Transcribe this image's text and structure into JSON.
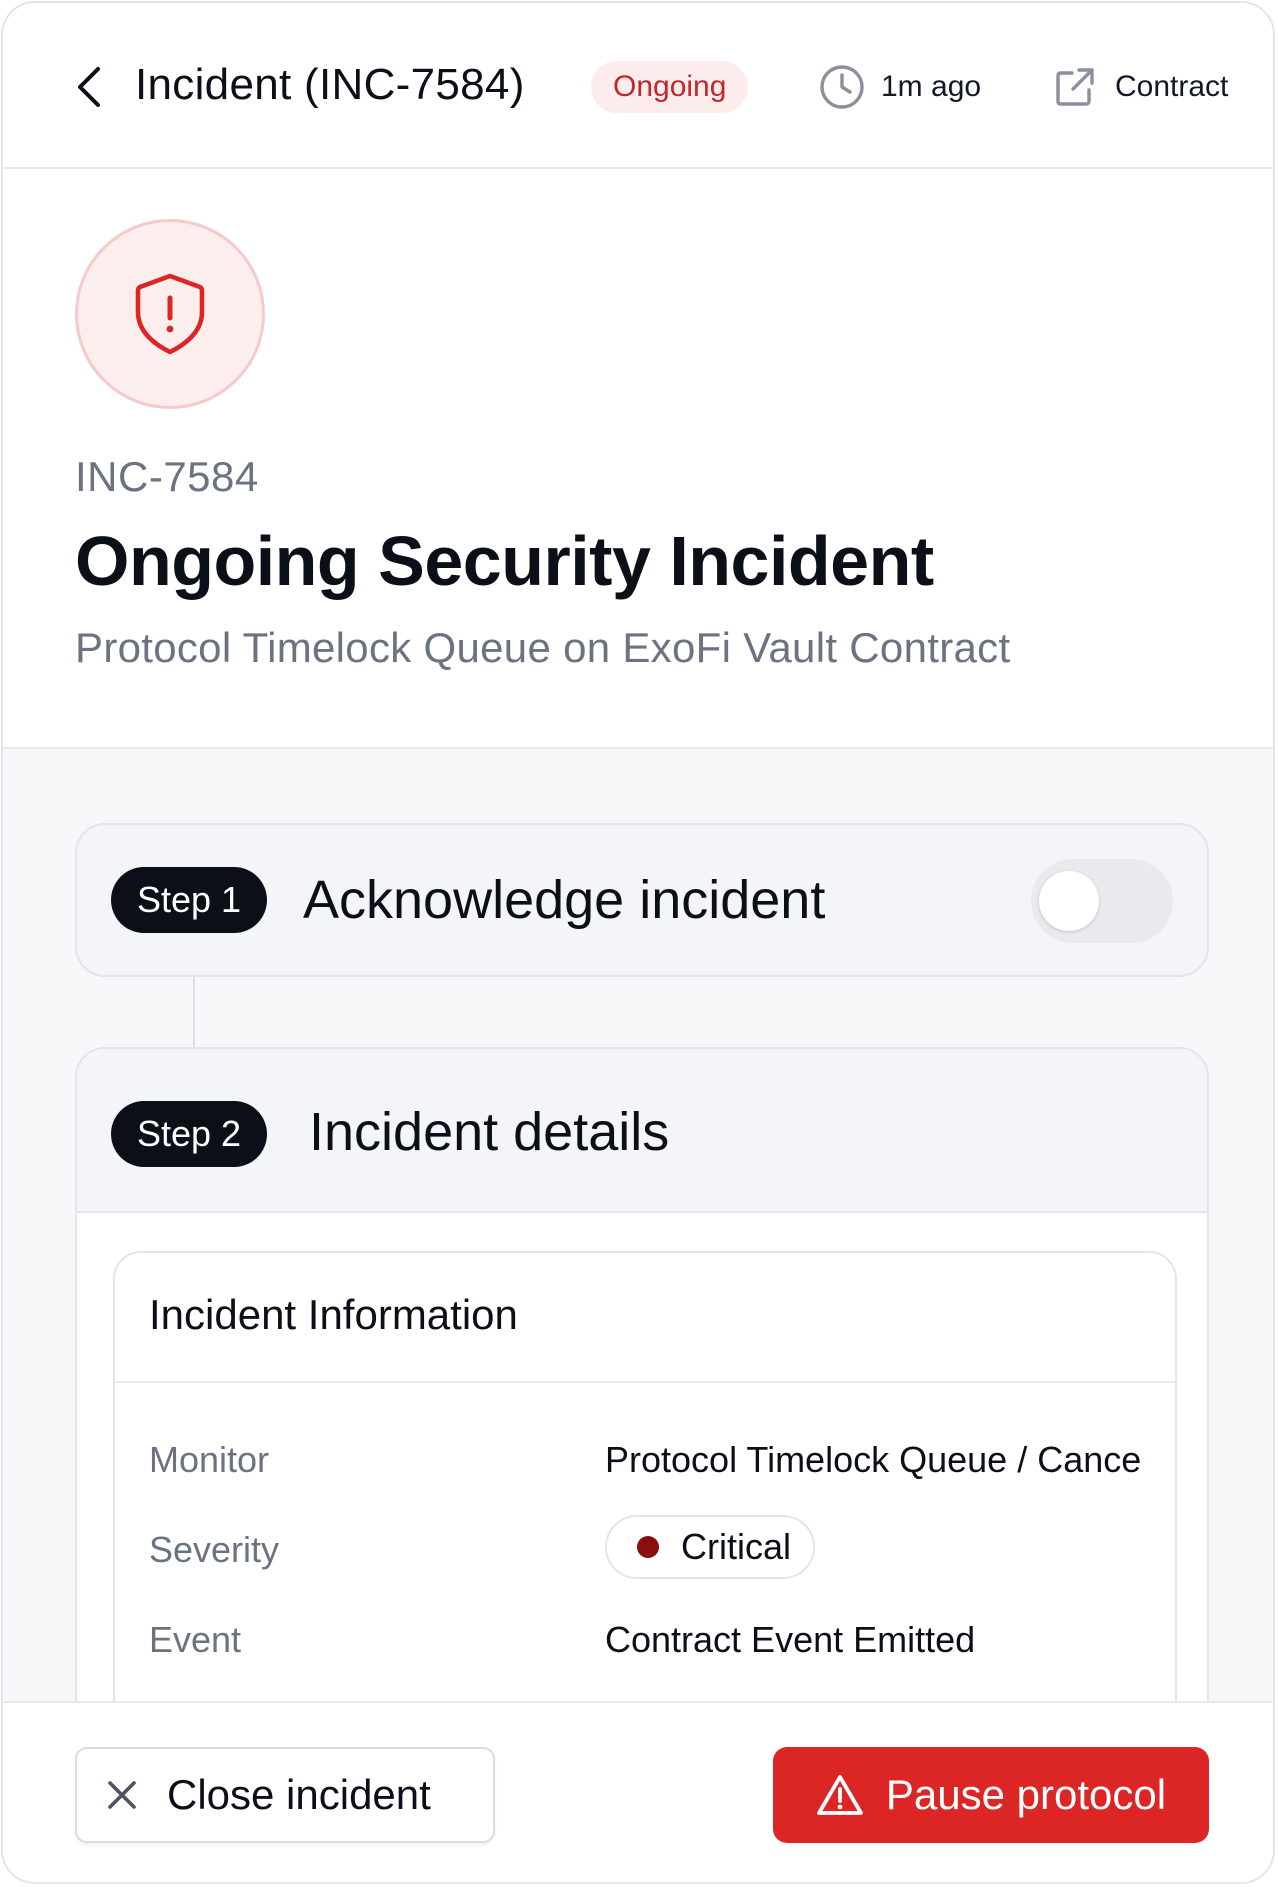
{
  "header": {
    "title": "Incident (INC-7584)",
    "status": "Ongoing",
    "time_ago": "1m ago",
    "contract_label": "Contract"
  },
  "hero": {
    "incident_id": "INC-7584",
    "title": "Ongoing Security Incident",
    "subtitle": "Protocol Timelock Queue on ExoFi Vault Contract",
    "icon": "shield-alert-icon"
  },
  "steps": [
    {
      "badge": "Step 1",
      "title": "Acknowledge incident",
      "toggle_on": false
    },
    {
      "badge": "Step 2",
      "title": "Incident details"
    }
  ],
  "incident_info": {
    "title": "Incident Information",
    "rows": [
      {
        "label": "Monitor",
        "value": "Protocol Timelock Queue / Cance"
      },
      {
        "label": "Severity",
        "value": "Critical"
      },
      {
        "label": "Event",
        "value": "Contract Event Emitted"
      }
    ]
  },
  "footer": {
    "close_label": "Close incident",
    "pause_label": "Pause protocol"
  },
  "colors": {
    "danger": "#dc2626",
    "status_text": "#c2272d",
    "status_bg": "#fdecec",
    "critical_dot": "#8b0e0e"
  }
}
